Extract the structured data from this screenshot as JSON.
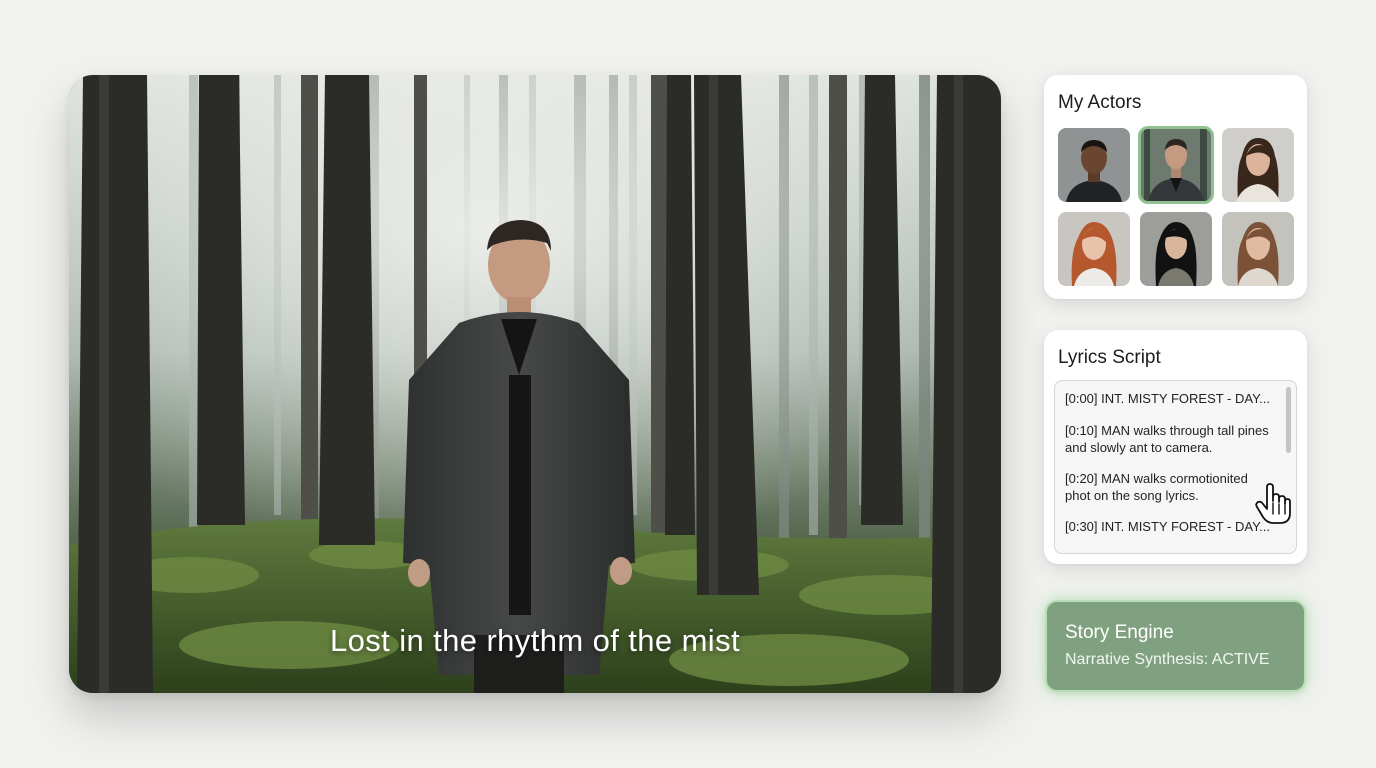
{
  "video": {
    "caption": "Lost in the rhythm of the mist"
  },
  "actors_panel": {
    "title": "My Actors",
    "actors": [
      {
        "icon": "actor-portrait-man-dark",
        "selected": false
      },
      {
        "icon": "actor-portrait-man-coat",
        "selected": true
      },
      {
        "icon": "actor-portrait-woman-brunette",
        "selected": false
      },
      {
        "icon": "actor-portrait-woman-redhead",
        "selected": false
      },
      {
        "icon": "actor-portrait-woman-black-hair",
        "selected": false
      },
      {
        "icon": "actor-portrait-woman-light-brown",
        "selected": false
      }
    ]
  },
  "lyrics_panel": {
    "title": "Lyrics Script",
    "lines": [
      "[0:00] INT. MISTY FOREST - DAY...",
      "[0:10] MAN walks through tall pines and slowly ant to camera.",
      "[0:20] MAN walks cormotionited phot on the song lyrics.",
      "[0:30] INT. MISTY FOREST - DAY..."
    ]
  },
  "story_engine": {
    "title": "Story Engine",
    "status": "Narrative Synthesis: ACTIVE"
  },
  "colors": {
    "background": "#f1f1ef",
    "accent_green": "#80a17f",
    "accent_glow": "#b9deb5",
    "selected_outline": "#8fc28e"
  }
}
